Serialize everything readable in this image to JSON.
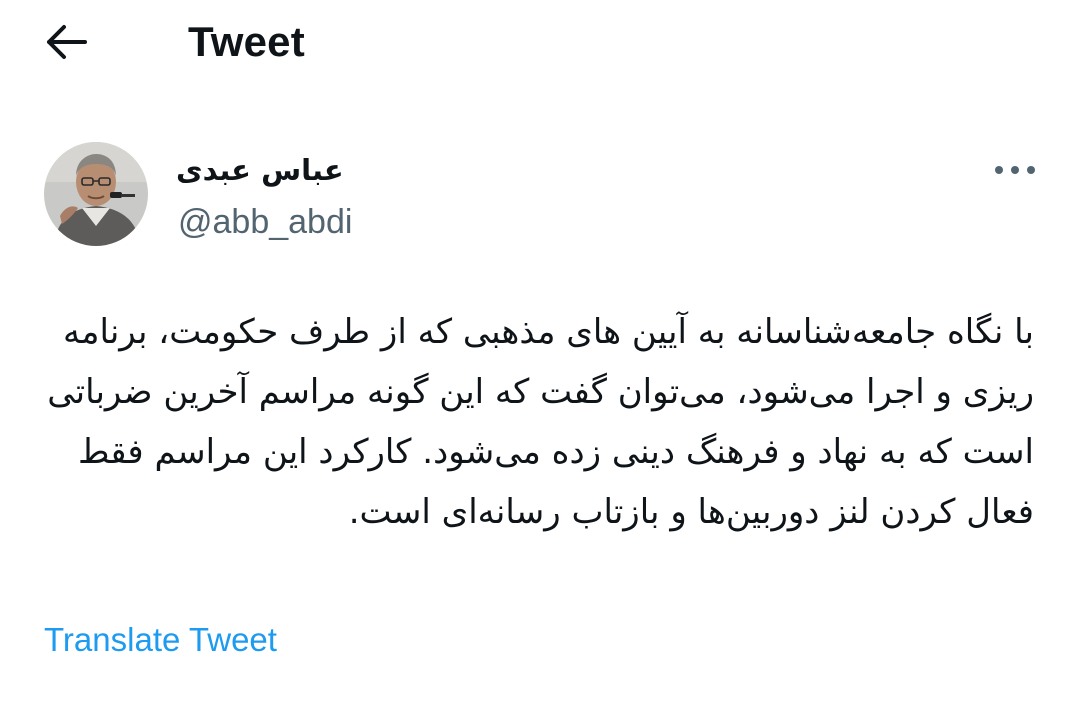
{
  "header": {
    "title": "Tweet",
    "back_icon": "arrow-left-icon"
  },
  "author": {
    "display_name": "عباس عبدی",
    "handle": "@abb_abdi",
    "avatar_icon": "avatar-photo"
  },
  "more_icon": "more-horizontal-icon",
  "tweet": {
    "text": "با نگاه جامعه‌شناسانه به آیین های مذهبی که از طرف حکومت، برنامه ریزی و اجرا می‌شود، می‌توان گفت که این گونه مراسم آخرین ضرباتی است که به نهاد و فرهنگ دینی زده می‌شود. کارکرد این مراسم فقط فعال کردن لنز دوربین‌ها و بازتاب رسانه‌ای است."
  },
  "translate_label": "Translate Tweet",
  "colors": {
    "text": "#0f1419",
    "secondary": "#536471",
    "link": "#1d9bf0",
    "background": "#ffffff"
  }
}
